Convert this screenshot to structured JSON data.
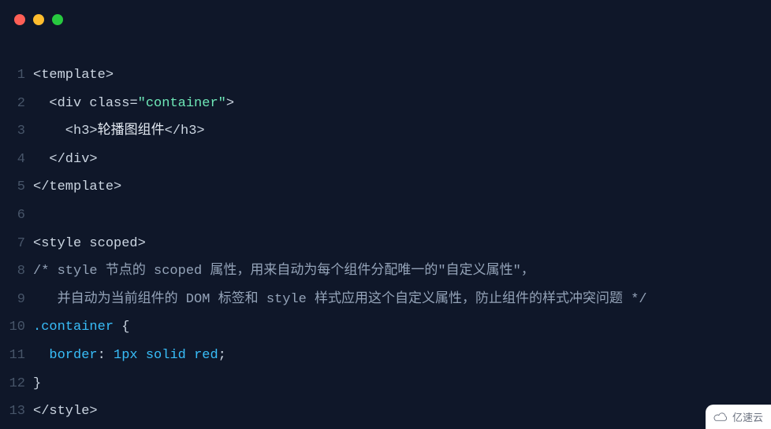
{
  "traffic_lights": {
    "close": "#ff5f56",
    "min": "#ffbd2e",
    "max": "#27c93f"
  },
  "lines": [
    {
      "n": "1",
      "tokens": [
        [
          "tag",
          "<template>"
        ]
      ]
    },
    {
      "n": "2",
      "tokens": [
        [
          "tag",
          "  <div "
        ],
        [
          "attr",
          "class"
        ],
        [
          "punct",
          "="
        ],
        [
          "str",
          "\"container\""
        ],
        [
          "tag",
          ">"
        ]
      ]
    },
    {
      "n": "3",
      "tokens": [
        [
          "tag",
          "    <h3>"
        ],
        [
          "text",
          "轮播图组件"
        ],
        [
          "tag",
          "</h3>"
        ]
      ]
    },
    {
      "n": "4",
      "tokens": [
        [
          "tag",
          "  </div>"
        ]
      ]
    },
    {
      "n": "5",
      "tokens": [
        [
          "tag",
          "</template>"
        ]
      ]
    },
    {
      "n": "6",
      "tokens": [
        [
          "code",
          ""
        ]
      ]
    },
    {
      "n": "7",
      "tokens": [
        [
          "tag",
          "<style "
        ],
        [
          "attr",
          "scoped"
        ],
        [
          "tag",
          ">"
        ]
      ]
    },
    {
      "n": "8",
      "tokens": [
        [
          "cm",
          "/* style 节点的 scoped 属性，用来自动为每个组件分配唯一的\"自定义属性\"，"
        ]
      ]
    },
    {
      "n": "9",
      "tokens": [
        [
          "cm",
          "   并自动为当前组件的 DOM 标签和 style 样式应用这个自定义属性，防止组件的样式冲突问题 */"
        ]
      ]
    },
    {
      "n": "10",
      "tokens": [
        [
          "sel",
          ".container"
        ],
        [
          "punct",
          " {"
        ]
      ]
    },
    {
      "n": "11",
      "tokens": [
        [
          "punct",
          "  "
        ],
        [
          "prop",
          "border"
        ],
        [
          "punct",
          ": "
        ],
        [
          "val",
          "1px"
        ],
        [
          "punct",
          " "
        ],
        [
          "keyw",
          "solid"
        ],
        [
          "punct",
          " "
        ],
        [
          "keyw",
          "red"
        ],
        [
          "punct",
          ";"
        ]
      ]
    },
    {
      "n": "12",
      "tokens": [
        [
          "punct",
          "}"
        ]
      ]
    },
    {
      "n": "13",
      "tokens": [
        [
          "tag",
          "</style>"
        ]
      ]
    }
  ],
  "watermark_text": "亿速云"
}
